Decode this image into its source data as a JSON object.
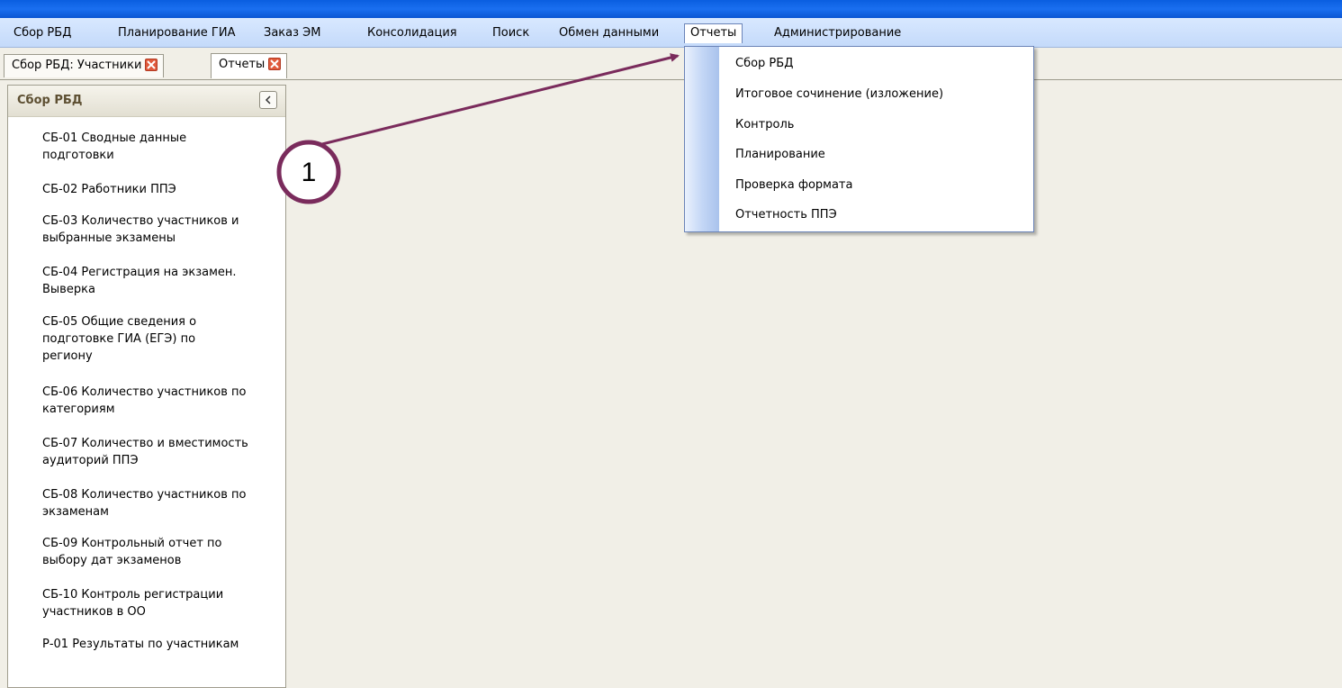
{
  "menubar": {
    "items": [
      "Сбор РБД",
      "Планирование ГИА",
      "Заказ ЭМ",
      "Консолидация",
      "Поиск",
      "Обмен данными",
      "Отчеты",
      "Администрирование"
    ],
    "active_index": 6
  },
  "tabs": [
    {
      "label": "Сбор РБД: Участники",
      "active": false
    },
    {
      "label": "Отчеты",
      "active": true
    }
  ],
  "sidebar": {
    "title": "Сбор РБД",
    "collapse_icon": "chevron-left-icon",
    "items": [
      {
        "line1": "СБ-01 Сводные данные",
        "line2": "подготовки"
      },
      {
        "line1": "СБ-02 Работники ППЭ"
      },
      {
        "line1": "СБ-03 Количество участников и",
        "line2": "выбранные экзамены"
      },
      {
        "line1": "СБ-04 Регистрация на экзамен.",
        "line2": "Выверка"
      },
      {
        "line1": "СБ-05 Общие сведения о",
        "line2": "подготовке ГИА (ЕГЭ) по",
        "line3": "региону"
      },
      {
        "line1": "СБ-06 Количество участников по",
        "line2": "категориям"
      },
      {
        "line1": "СБ-07 Количество и вместимость",
        "line2": "аудиторий ППЭ"
      },
      {
        "line1": "СБ-08 Количество участников по",
        "line2": "экзаменам"
      },
      {
        "line1": "СБ-09 Контрольный отчет по",
        "line2": "выбору дат экзаменов"
      },
      {
        "line1": "СБ-10 Контроль регистрации",
        "line2": "участников в ОО"
      },
      {
        "line1": "Р-01 Результаты по участникам"
      }
    ]
  },
  "reports_menu": {
    "items": [
      "Сбор РБД",
      "Итоговое сочинение (изложение)",
      "Контроль",
      "Планирование",
      "Проверка формата",
      "Отчетность ППЭ"
    ]
  },
  "annotation": {
    "number": "1",
    "color": "#7a2b5c"
  },
  "colors": {
    "title_bar": "#0a5ee0",
    "menubar": "#c9ddfb",
    "panel_title": "#5d4f32",
    "tab_close": "#e05a3c"
  }
}
